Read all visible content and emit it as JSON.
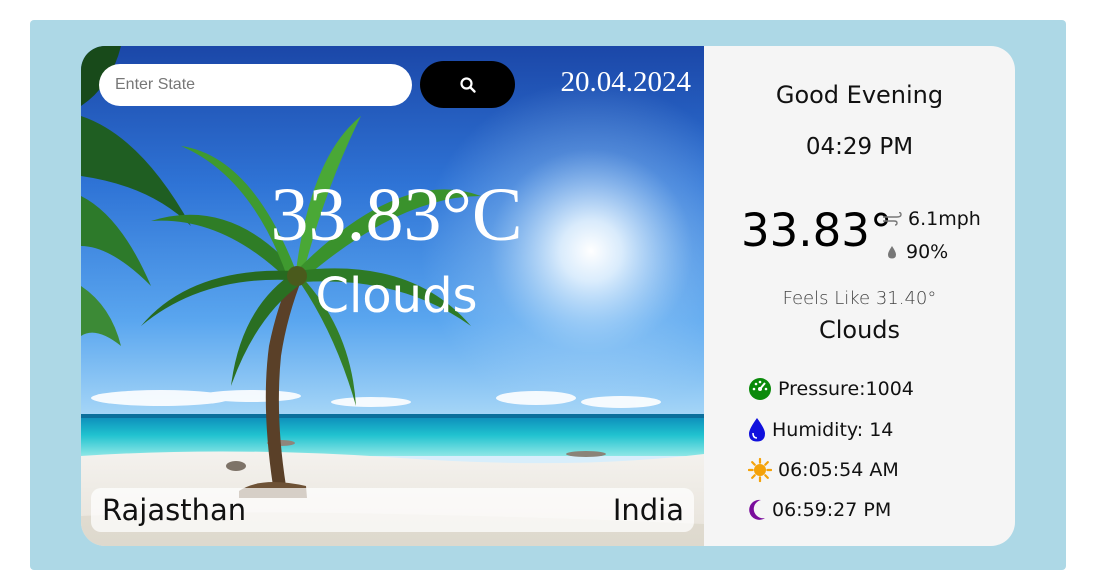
{
  "search": {
    "placeholder": "Enter State",
    "value": "",
    "button_icon": "search-icon"
  },
  "date": "20.04.2024",
  "hero": {
    "temperature": "33.83°C",
    "condition": "Clouds"
  },
  "location": {
    "state": "Rajasthan",
    "country": "India"
  },
  "info": {
    "greeting": "Good Evening",
    "time": "04:29 PM",
    "temperature": "33.83°",
    "wind": "6.1mph",
    "precipitation": "90%",
    "feels_like": "Feels Like 31.40°",
    "condition": "Clouds",
    "details": [
      {
        "icon": "pressure-gauge-icon",
        "label": "Pressure:1004",
        "color": "#0a8a0a"
      },
      {
        "icon": "humidity-drop-icon",
        "label": "Humidity: 14",
        "color": "#1010dd"
      },
      {
        "icon": "sunrise-sun-icon",
        "label": "06:05:54 AM",
        "color": "#f4a20a"
      },
      {
        "icon": "sunset-moon-icon",
        "label": "06:59:27 PM",
        "color": "#7a0d9c"
      }
    ]
  },
  "colors": {
    "frame": "#add8e6",
    "panel": "#f5f5f5",
    "button": "#000000"
  }
}
